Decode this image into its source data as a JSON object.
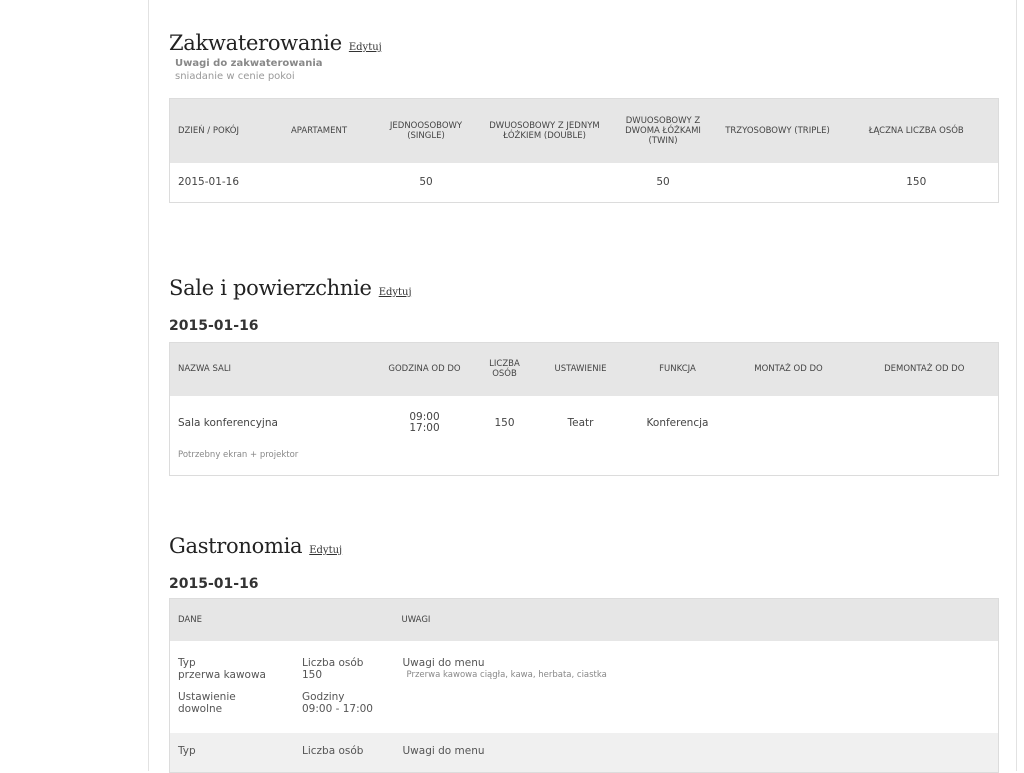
{
  "accommodation": {
    "title": "Zakwaterowanie",
    "edit": "Edytuj",
    "notes_label": "Uwagi do zakwaterowania",
    "notes_text": "sniadanie w cenie pokoi",
    "headers": [
      "DZIEŃ / POKÓJ",
      "APARTAMENT",
      "JEDNOOSOBOWY (SINGLE)",
      "DWUOSOBOWY Z JEDNYM ŁÓŻKIEM (DOUBLE)",
      "DWUOSOBOWY Z DWOMA ŁÓŻKAMI (TWIN)",
      "TRZYOSOBOWY (TRIPLE)",
      "ŁĄCZNA LICZBA OSÓB"
    ],
    "row": {
      "day": "2015-01-16",
      "apartment": "",
      "single": "50",
      "double": "",
      "twin": "50",
      "triple": "",
      "total": "150"
    }
  },
  "rooms": {
    "title": "Sale i powierzchnie",
    "edit": "Edytuj",
    "date": "2015-01-16",
    "headers": [
      "NAZWA SALI",
      "GODZINA OD DO",
      "LICZBA OSÓB",
      "USTAWIENIE",
      "FUNKCJA",
      "MONTAŻ OD DO",
      "DEMONTAŻ OD DO"
    ],
    "row": {
      "name": "Sala konferencyjna",
      "time_from": "09:00",
      "time_to": "17:00",
      "people": "150",
      "setup": "Teatr",
      "function": "Konferencja",
      "assembly": "",
      "disassembly": ""
    },
    "note": "Potrzebny ekran + projektor"
  },
  "gastronomy": {
    "title": "Gastronomia",
    "edit": "Edytuj",
    "date": "2015-01-16",
    "headers": [
      "DANE",
      "UWAGI"
    ],
    "row1": {
      "type_label": "Typ",
      "type_value": "przerwa kawowa",
      "people_label": "Liczba osób",
      "people_value": "150",
      "setup_label": "Ustawienie",
      "setup_value": "dowolne",
      "hours_label": "Godziny",
      "hours_value": "09:00 -  17:00",
      "menu_label": "Uwagi do menu",
      "menu_note": "Przerwa kawowa ciągła, kawa, herbata, ciastka"
    },
    "row2": {
      "type_label": "Typ",
      "people_label": "Liczba osób",
      "menu_label": "Uwagi do menu"
    }
  }
}
